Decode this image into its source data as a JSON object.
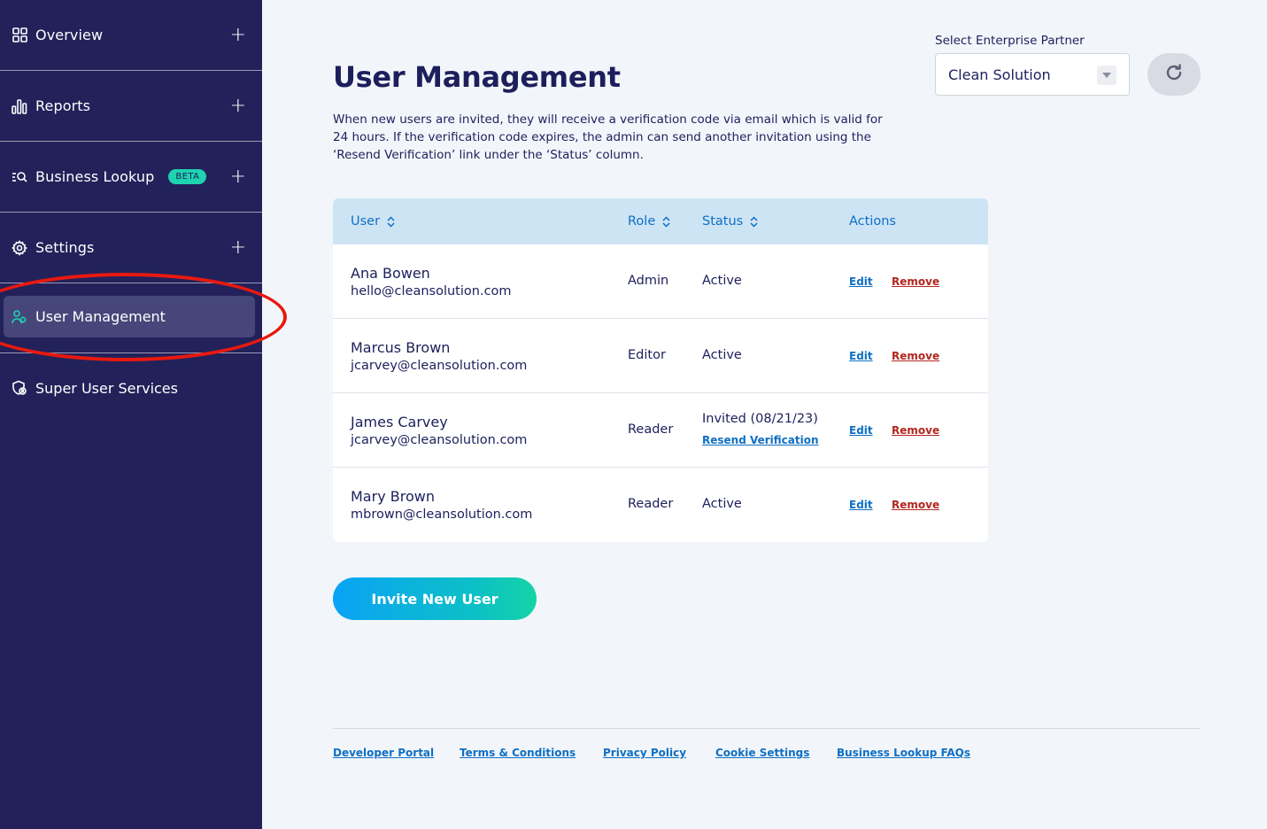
{
  "sidebar": {
    "items": [
      {
        "label": "Overview",
        "icon": "grid-icon"
      },
      {
        "label": "Reports",
        "icon": "bar-chart-icon"
      },
      {
        "label": "Business Lookup",
        "icon": "list-search-icon",
        "badge": "BETA"
      },
      {
        "label": "Settings",
        "icon": "gear-icon"
      }
    ],
    "active": {
      "label": "User Management",
      "icon": "users-icon"
    },
    "extra": {
      "label": "Super User Services",
      "icon": "shield-user-icon"
    },
    "expand_symbol": "+"
  },
  "page": {
    "title": "User Management",
    "description": "When new users are invited, they will receive a verification code via email which is valid for 24 hours. If the verification code expires, the admin can send another invitation using the ‘Resend Verification’ link under the ‘Status’ column."
  },
  "partner": {
    "label": "Select Enterprise Partner",
    "selected": "Clean Solution"
  },
  "table": {
    "headers": {
      "user": "User",
      "role": "Role",
      "status": "Status",
      "actions": "Actions"
    },
    "rows": [
      {
        "name": "Ana Bowen",
        "email": "hello@cleansolution.com",
        "role": "Admin",
        "status": "Active",
        "edit": "Edit",
        "remove": "Remove"
      },
      {
        "name": "Marcus Brown",
        "email": "jcarvey@cleansolution.com",
        "role": "Editor",
        "status": "Active",
        "edit": "Edit",
        "remove": "Remove"
      },
      {
        "name": "James Carvey",
        "email": "jcarvey@cleansolution.com",
        "role": "Reader",
        "status": "Invited (08/21/23)",
        "resend": "Resend Verification",
        "edit": "Edit",
        "remove": "Remove"
      },
      {
        "name": "Mary Brown",
        "email": "mbrown@cleansolution.com",
        "role": "Reader",
        "status": "Active",
        "edit": "Edit",
        "remove": "Remove"
      }
    ]
  },
  "invite_button": "Invite New User",
  "footer": {
    "links": [
      "Developer Portal",
      "Terms & Conditions",
      "Privacy Policy",
      "Cookie Settings",
      "Business Lookup FAQs"
    ]
  },
  "colors": {
    "sidebar_bg": "#23215a",
    "accent_blue": "#0f6fc4",
    "remove_red": "#b3261e",
    "beta_teal": "#1ed3b0",
    "highlight_red": "#e8190f"
  }
}
